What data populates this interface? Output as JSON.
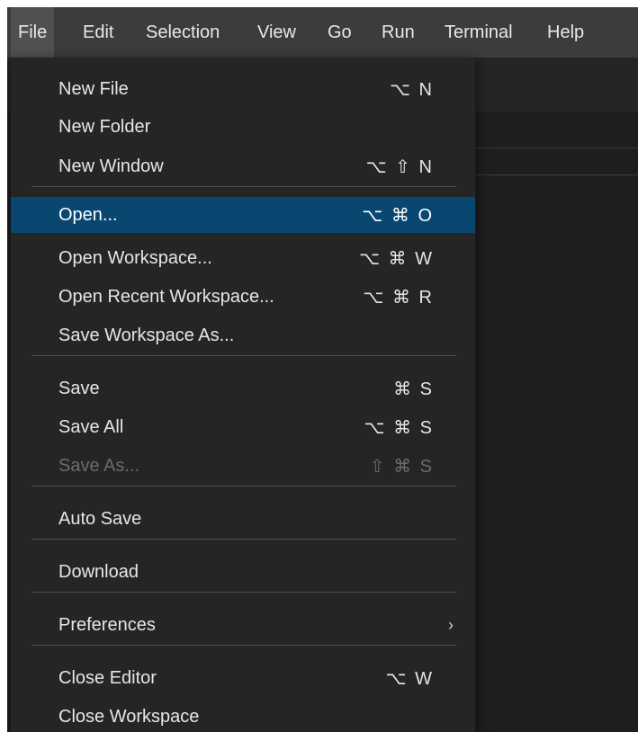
{
  "menubar": {
    "items": [
      "File",
      "Edit",
      "Selection",
      "View",
      "Go",
      "Run",
      "Terminal",
      "Help"
    ]
  },
  "file_menu": {
    "items": [
      {
        "label": "New File",
        "shortcut": "⌥ N"
      },
      {
        "label": "New Folder",
        "shortcut": ""
      },
      {
        "label": "New Window",
        "shortcut": "⌥ ⇧ N"
      },
      {
        "label": "Open...",
        "shortcut": "⌥ ⌘ O"
      },
      {
        "label": "Open Workspace...",
        "shortcut": "⌥ ⌘ W"
      },
      {
        "label": "Open Recent Workspace...",
        "shortcut": "⌥ ⌘ R"
      },
      {
        "label": "Save Workspace As...",
        "shortcut": ""
      },
      {
        "label": "Save",
        "shortcut": "⌘ S"
      },
      {
        "label": "Save All",
        "shortcut": "⌥ ⌘ S"
      },
      {
        "label": "Save As...",
        "shortcut": "⇧ ⌘ S"
      },
      {
        "label": "Auto Save",
        "shortcut": ""
      },
      {
        "label": "Download",
        "shortcut": ""
      },
      {
        "label": "Preferences",
        "shortcut": ""
      },
      {
        "label": "Close Editor",
        "shortcut": "⌥ W"
      },
      {
        "label": "Close Workspace",
        "shortcut": ""
      }
    ],
    "submenu_chevron": "›"
  },
  "colors": {
    "menubar_bg": "#3c3c3c",
    "menu_bg": "#252526",
    "highlight_bg": "#094771",
    "text": "#e6e6e6",
    "disabled_text": "#6b6b6b"
  }
}
